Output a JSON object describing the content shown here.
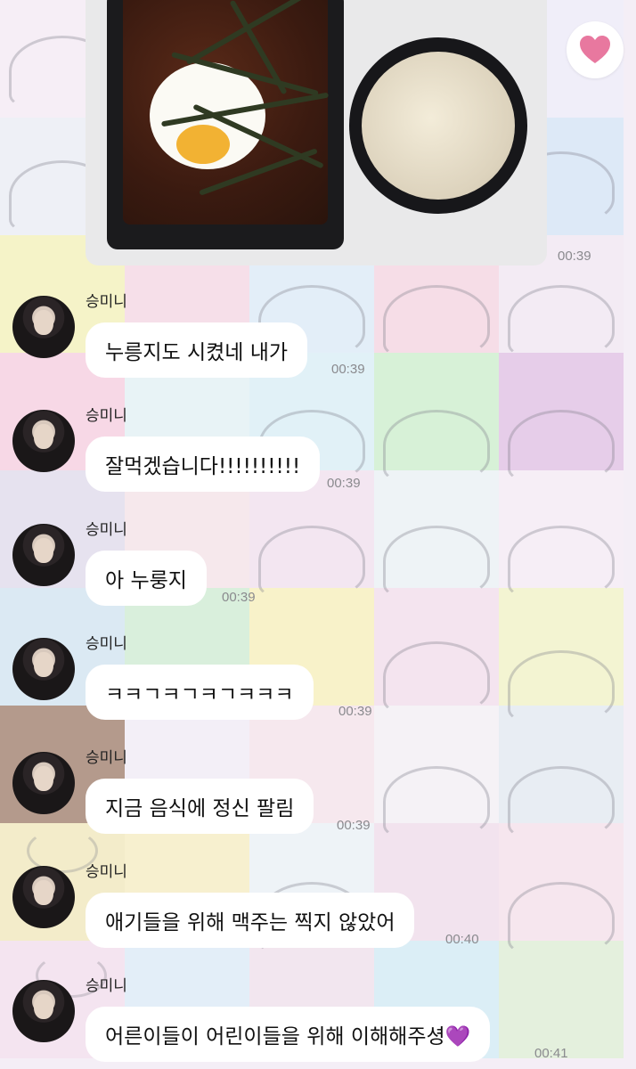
{
  "chat": {
    "photo_time": "00:39",
    "reaction_icon": "heart-icon",
    "sender": "승미니",
    "messages": [
      {
        "text": "누릉지도 시켰네 내가",
        "time": "00:39"
      },
      {
        "text": "잘먹겠습니다!!!!!!!!!!",
        "time": "00:39"
      },
      {
        "text": "아 누룽지",
        "time": "00:39"
      },
      {
        "text": "ㅋㅋㄱㅋㄱㅋㄱㅋㅋㅋ",
        "time": "00:39"
      },
      {
        "text": "지금 음식에 정신 팔림",
        "time": "00:39"
      },
      {
        "text": "애기들을 위해 맥주는 찍지 않았어",
        "time": "00:40"
      },
      {
        "text": "어른이들이 어린이들을 위해 이해해주셩💜",
        "time": "00:41"
      }
    ]
  },
  "colors": {
    "heart": "#e8789f",
    "bubble": "#ffffff",
    "time": "#8a8a8e"
  }
}
